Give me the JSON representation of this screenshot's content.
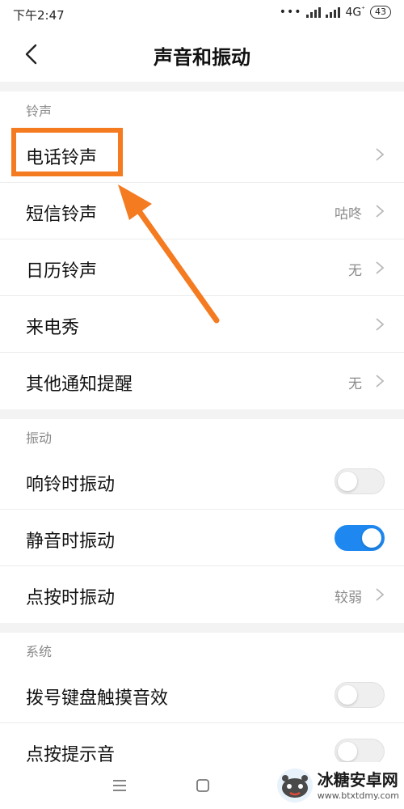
{
  "status_bar": {
    "time": "下午2:47",
    "dots": "•••",
    "network": "4G",
    "network_sub": "⁺",
    "battery": "43"
  },
  "header": {
    "title": "声音和振动"
  },
  "sections": [
    {
      "title": "铃声"
    },
    {
      "title": "振动"
    },
    {
      "title": "系统"
    }
  ],
  "ringtone_rows": [
    {
      "label": "电话铃声",
      "value": ""
    },
    {
      "label": "短信铃声",
      "value": "咕咚"
    },
    {
      "label": "日历铃声",
      "value": "无"
    },
    {
      "label": "来电秀",
      "value": ""
    },
    {
      "label": "其他通知提醒",
      "value": "无"
    }
  ],
  "vibration_rows": [
    {
      "label": "响铃时振动",
      "toggle": false
    },
    {
      "label": "静音时振动",
      "toggle": true
    },
    {
      "label": "点按时振动",
      "value": "较弱"
    }
  ],
  "system_rows": [
    {
      "label": "拨号键盘触摸音效",
      "toggle": false
    },
    {
      "label": "点按提示音",
      "toggle": false
    }
  ],
  "watermark": {
    "title": "冰糖安卓网",
    "url": "www.btxtdmy.com"
  },
  "colors": {
    "accent": "#1e88f0",
    "highlight": "#f47b20",
    "divider": "#f3f3f3",
    "secondary_text": "#8a8a8a"
  }
}
